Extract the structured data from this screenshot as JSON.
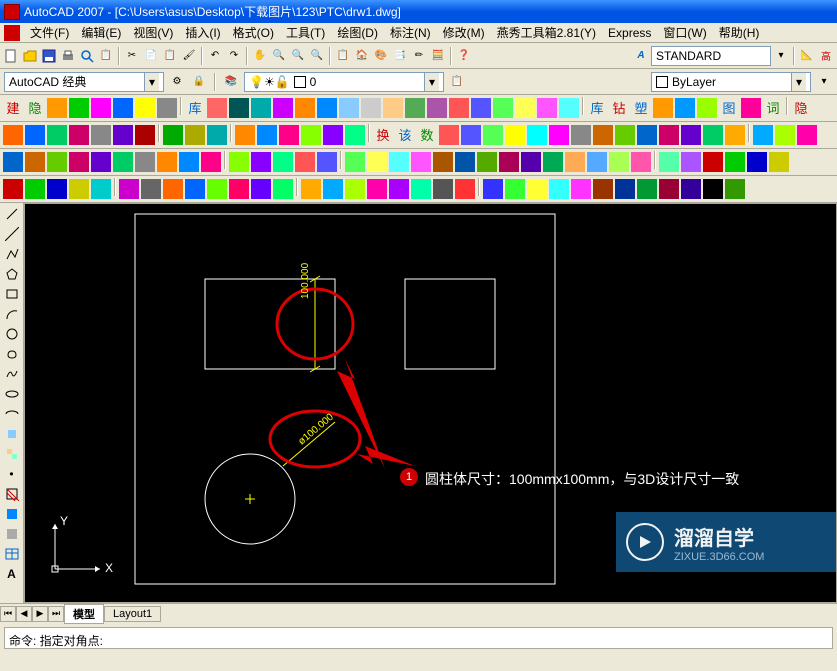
{
  "title_bar": {
    "app_name": "AutoCAD 2007",
    "file_path": "[C:\\Users\\asus\\Desktop\\下载图片\\123\\PTC\\drw1.dwg]"
  },
  "menu": {
    "items": [
      {
        "label": "文件(F)"
      },
      {
        "label": "编辑(E)"
      },
      {
        "label": "视图(V)"
      },
      {
        "label": "插入(I)"
      },
      {
        "label": "格式(O)"
      },
      {
        "label": "工具(T)"
      },
      {
        "label": "绘图(D)"
      },
      {
        "label": "标注(N)"
      },
      {
        "label": "修改(M)"
      },
      {
        "label": "燕秀工具箱2.81(Y)"
      },
      {
        "label": "Express"
      },
      {
        "label": "窗口(W)"
      },
      {
        "label": "帮助(H)"
      }
    ]
  },
  "workspace_combo": {
    "value": "AutoCAD 经典"
  },
  "layer_combo": {
    "value": "0"
  },
  "linetype_combo": {
    "value": "ByLayer"
  },
  "style_combo": {
    "value": "STANDARD"
  },
  "canvas": {
    "dim1": "100.000",
    "dim2": "ø100.000",
    "axis_x": "X",
    "axis_y": "Y"
  },
  "annotation": {
    "badge": "1",
    "text": "圆柱体尺寸：100mmx100mm，与3D设计尺寸一致"
  },
  "tabs": {
    "model": "模型",
    "layout1": "Layout1"
  },
  "command_line": {
    "prompt": "命令: 指定对角点:"
  },
  "watermark": {
    "title": "溜溜自学",
    "url": "ZIXUE.3D66.COM"
  },
  "toolbar_chinese_labels": {
    "jian": "建",
    "yin": "隐",
    "lib": "库",
    "huan": "换",
    "gai": "该",
    "shu": "数",
    "su": "塑",
    "ku2": "库",
    "tu": "图",
    "ci": "词",
    "yin2": "隐",
    "zuan": "钻"
  }
}
